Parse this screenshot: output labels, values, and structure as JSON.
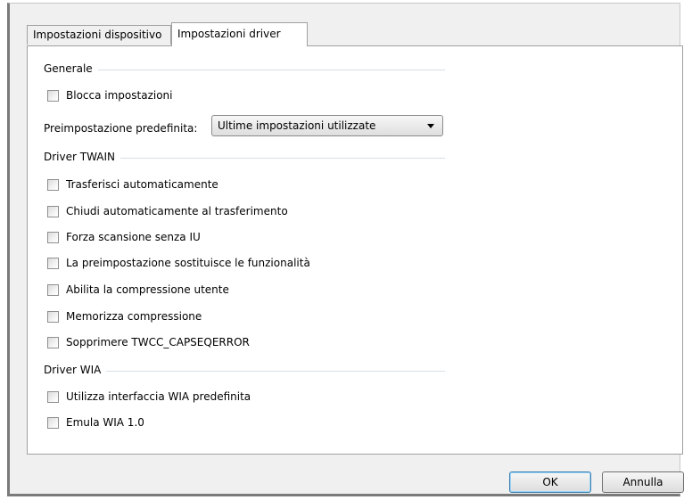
{
  "tabs": {
    "device_settings": "Impostazioni dispositivo",
    "driver_settings": "Impostazioni driver"
  },
  "general": {
    "title": "Generale",
    "lock_settings": {
      "label": "Blocca impostazioni",
      "checked": false
    },
    "preset_label": "Preimpostazione predefinita:",
    "preset_value": "Ultime impostazioni utilizzate"
  },
  "twain": {
    "title": "Driver TWAIN",
    "options": [
      {
        "label": "Trasferisci automaticamente",
        "checked": false
      },
      {
        "label": "Chiudi automaticamente al trasferimento",
        "checked": false
      },
      {
        "label": "Forza scansione senza IU",
        "checked": false
      },
      {
        "label": "La preimpostazione sostituisce le funzionalità",
        "checked": false
      },
      {
        "label": "Abilita la compressione utente",
        "checked": false
      },
      {
        "label": "Memorizza compressione",
        "checked": false
      },
      {
        "label": "Sopprimere TWCC_CAPSEQERROR",
        "checked": false
      }
    ]
  },
  "wia": {
    "title": "Driver WIA",
    "options": [
      {
        "label": "Utilizza interfaccia WIA predefinita",
        "checked": false
      },
      {
        "label": "Emula WIA 1.0",
        "checked": false
      }
    ]
  },
  "buttons": {
    "ok": "OK",
    "cancel": "Annulla"
  }
}
